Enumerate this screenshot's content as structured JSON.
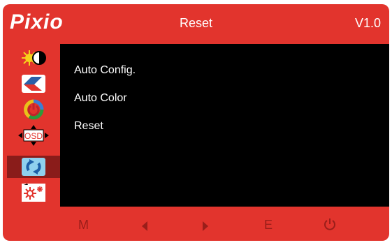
{
  "header": {
    "logo": "Pixio",
    "title": "Reset",
    "version": "V1.0"
  },
  "sidebar": {
    "items": [
      {
        "icon": "brightness-contrast-icon",
        "active": false
      },
      {
        "icon": "image-adjust-icon",
        "active": false
      },
      {
        "icon": "color-icon",
        "active": false
      },
      {
        "icon": "osd-icon",
        "label": "OSD",
        "active": false
      },
      {
        "icon": "reset-icon",
        "active": true
      },
      {
        "icon": "misc-settings-icon",
        "active": false
      }
    ]
  },
  "menu": {
    "items": [
      "Auto Config.",
      "Auto Color",
      "Reset"
    ]
  },
  "footer": {
    "menu_label": "M",
    "exit_label": "E"
  },
  "colors": {
    "frame": "#e2342d",
    "content": "#000000",
    "active_item": "#8a1c1a",
    "footer_glyph": "#9a1e1a"
  }
}
